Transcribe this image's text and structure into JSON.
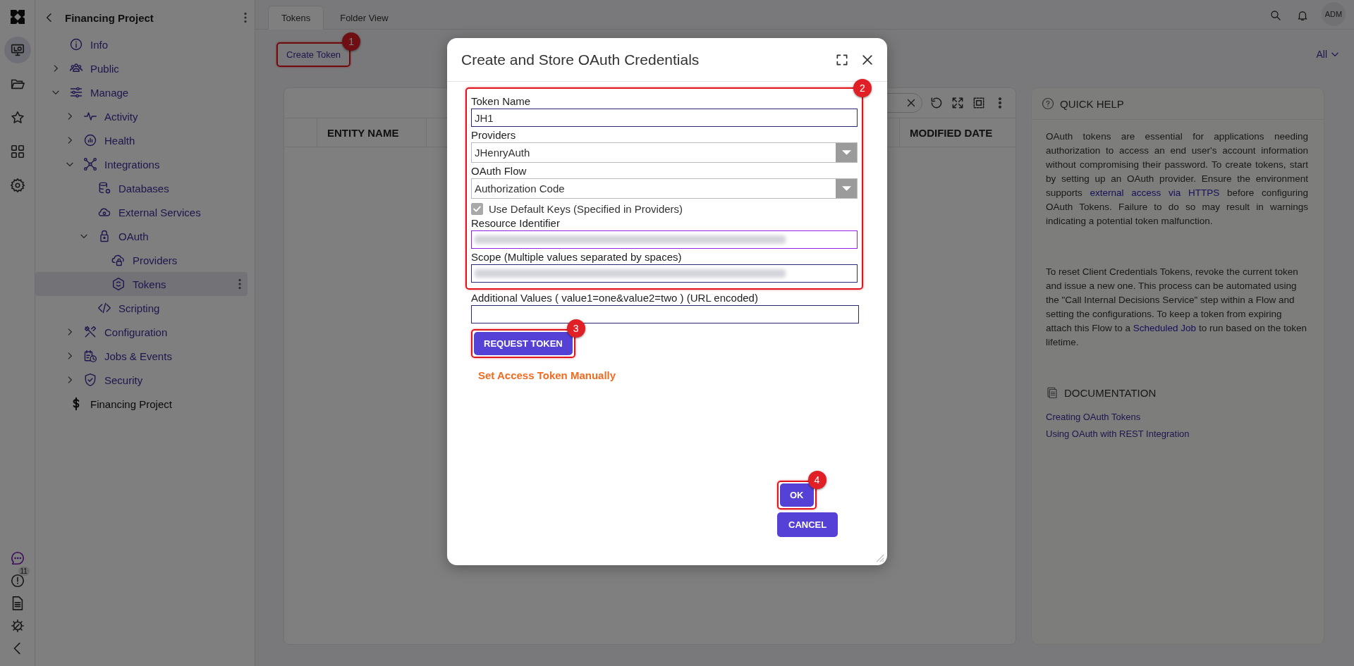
{
  "rail": {
    "items": [
      {
        "selected": true
      },
      {
        "selected": false
      },
      {
        "selected": false
      },
      {
        "selected": false
      },
      {
        "selected": false
      }
    ],
    "alert_count": "11"
  },
  "sidebar": {
    "title": "Financing Project",
    "tree": [
      {
        "label": "Info"
      },
      {
        "label": "Public",
        "expanded": false
      },
      {
        "label": "Manage",
        "expanded": true,
        "children": [
          {
            "label": "Activity",
            "expanded": false
          },
          {
            "label": "Health",
            "expanded": false
          },
          {
            "label": "Integrations",
            "expanded": true,
            "children": [
              {
                "label": "Databases"
              },
              {
                "label": "External Services"
              },
              {
                "label": "OAuth",
                "expanded": true,
                "children": [
                  {
                    "label": "Providers",
                    "selected": false
                  },
                  {
                    "label": "Tokens",
                    "selected": true
                  }
                ]
              },
              {
                "label": "Scripting"
              }
            ]
          },
          {
            "label": "Configuration",
            "expanded": false
          },
          {
            "label": "Jobs & Events",
            "expanded": false
          },
          {
            "label": "Security",
            "expanded": false
          }
        ]
      },
      {
        "label": "Financing Project"
      }
    ]
  },
  "tabs": [
    {
      "label": "Tokens",
      "selected": true
    },
    {
      "label": "Folder View",
      "selected": false
    }
  ],
  "user": "ADM",
  "create_button": "Create Token",
  "filter": "All",
  "table": {
    "columns": [
      "ENTITY NAME",
      "MODIFIED DATE"
    ]
  },
  "quick_help": {
    "title": "QUICK HELP",
    "paragraphs": [
      [
        {
          "text": "OAuth tokens are essential for applications needing authorization to access an end user's account information without compromising their password. To create tokens, start by setting up an OAuth provider. Ensure the environment supports "
        },
        {
          "text": "external access via HTTPS",
          "link": true
        },
        {
          "text": " before configuring OAuth Tokens. Failure to do so may result in warnings indicating a potential token malfunction."
        }
      ],
      [
        {
          "text": "To reset Client Credentials Tokens, revoke the current token and issue a new one. This process can be automated using the \"Call Internal Decisions Service\" step within a Flow and setting the configurations. To keep a token from expiring attach this Flow to a "
        },
        {
          "text": "Scheduled Job",
          "link": true
        },
        {
          "text": " to run based on the token lifetime."
        }
      ]
    ],
    "docs_title": "DOCUMENTATION",
    "docs_links": [
      "Creating OAuth Tokens",
      "Using OAuth with REST Integration"
    ]
  },
  "dialog": {
    "title": "Create and Store OAuth Credentials",
    "fields": [
      {
        "kind": "text",
        "label": "Token Name",
        "value": "JH1"
      },
      {
        "kind": "select",
        "label": "Providers",
        "value": "JHenryAuth"
      },
      {
        "kind": "select",
        "label": "OAuth Flow",
        "value": "Authorization Code"
      },
      {
        "kind": "checkbox",
        "label": "Use Default Keys (Specified in Providers)",
        "checked": true,
        "disabled": true
      },
      {
        "kind": "text",
        "label": "Resource Identifier",
        "focused": true,
        "blurred": true
      },
      {
        "kind": "text",
        "label": "Scope (Multiple values separated by spaces)",
        "blurred": true
      },
      {
        "kind": "text",
        "label": "Additional Values ( value1=one&value2=two ) (URL encoded)"
      }
    ],
    "request_button": "REQUEST TOKEN",
    "manual_link": "Set Access Token Manually",
    "ok_button": "OK",
    "cancel_button": "CANCEL"
  },
  "annotations": [
    "1",
    "2",
    "3",
    "4"
  ]
}
